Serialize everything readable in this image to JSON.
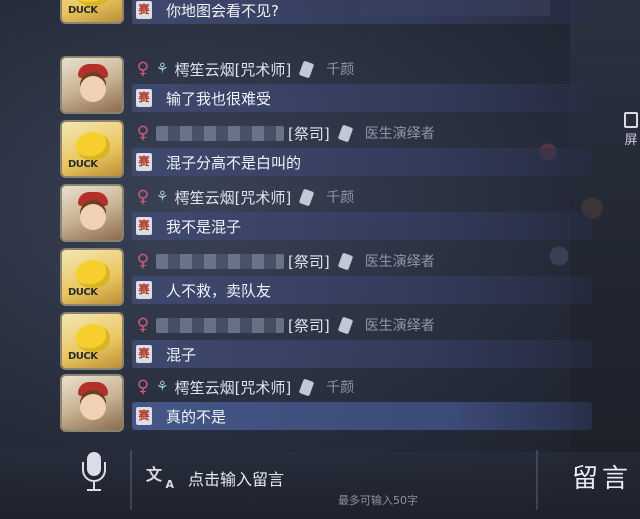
{
  "side_tab": {
    "label": "屏"
  },
  "messages": [
    {
      "avatar": "duck-avatar",
      "sender": null,
      "text": "你地图会看不见?"
    },
    {
      "avatar": "girl-avatar",
      "gender": "♀",
      "nick": "樗笙云烟[咒术师]",
      "role": "千颜",
      "season": "赛",
      "text": "输了我也很难受"
    },
    {
      "avatar": "duck-avatar",
      "gender": "♀",
      "tag": "[祭司]",
      "role": "医生演绎者",
      "season": "赛",
      "text": "混子分高不是白叫的"
    },
    {
      "avatar": "girl-avatar",
      "gender": "♀",
      "nick": "樗笙云烟[咒术师]",
      "role": "千颜",
      "season": "赛",
      "text": "我不是混子"
    },
    {
      "avatar": "duck-avatar",
      "gender": "♀",
      "tag": "[祭司]",
      "role": "医生演绎者",
      "season": "赛",
      "text": "人不救，卖队友"
    },
    {
      "avatar": "duck-avatar",
      "gender": "♀",
      "tag": "[祭司]",
      "role": "医生演绎者",
      "season": "赛",
      "text": "混子"
    },
    {
      "avatar": "girl-avatar",
      "gender": "♀",
      "nick": "樗笙云烟[咒术师]",
      "role": "千颜",
      "season": "赛",
      "text": "真的不是"
    }
  ],
  "first_season": "赛",
  "compose": {
    "placeholder": "点击输入留言",
    "limit": "最多可输入50字",
    "post_label": "留言"
  },
  "icons": {
    "mic": "microphone-icon",
    "translate": "voice-to-text-icon",
    "deer": "deer-antler-icon",
    "badge": "feather-badge-icon"
  }
}
